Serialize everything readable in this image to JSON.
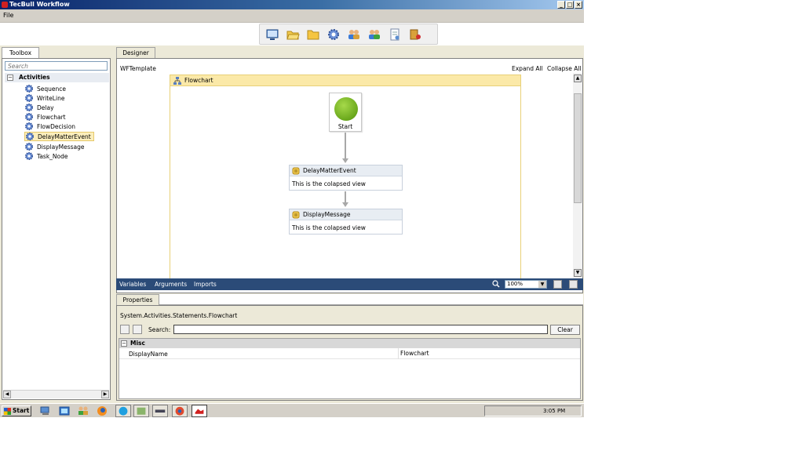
{
  "window": {
    "title": "TecBull Workflow"
  },
  "menu": {
    "file": "File"
  },
  "toolbox": {
    "tab_label": "Toolbox",
    "search_placeholder": "Search",
    "category": "Activities",
    "items": [
      "Sequence",
      "WriteLine",
      "Delay",
      "Flowchart",
      "FlowDecision",
      "DelayMatterEvent",
      "DisplayMessage",
      "Task_Node"
    ],
    "selected": "DelayMatterEvent"
  },
  "designer": {
    "tab_label": "Designer",
    "breadcrumb": "WFTemplate",
    "expand_all": "Expand All",
    "collapse_all": "Collapse All",
    "flowchart_title": "Flowchart",
    "start_label": "Start",
    "activities": [
      {
        "title": "DelayMatterEvent",
        "body": "This is the colapsed view"
      },
      {
        "title": "DisplayMessage",
        "body": "This is the colapsed view"
      }
    ],
    "bottom_bar": {
      "variables": "Variables",
      "arguments": "Arguments",
      "imports": "Imports",
      "zoom": "100%"
    }
  },
  "properties": {
    "tab_label": "Properties",
    "type_name": "System.Activities.Statements.Flowchart",
    "search_label": "Search:",
    "clear_label": "Clear",
    "category": "Misc",
    "rows": [
      {
        "key": "DisplayName",
        "value": "Flowchart"
      }
    ]
  },
  "taskbar": {
    "start_label": "Start",
    "clock": "3:05 PM"
  },
  "colors": {
    "title_bar": "#0a246a",
    "flowchart_header": "#fbe9a8",
    "variables_bar": "#2b4b78",
    "start_node": "#6aa81c"
  }
}
